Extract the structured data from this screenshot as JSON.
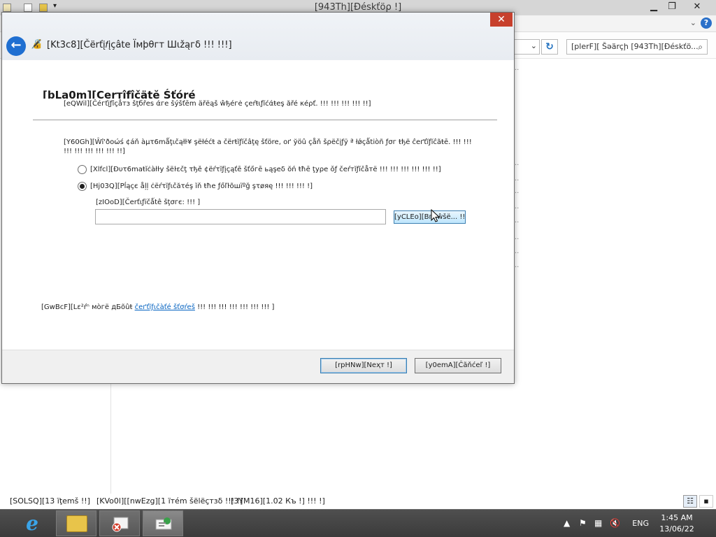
{
  "explorer": {
    "title": "[943Th][Ðéskťöρ !]",
    "search_placeholder": "[plerF][ Šəärçḩ [943Th][Ðéskťö...",
    "status": {
      "items": "[SOLSQ][13 ïţemš !!]",
      "selected": "[KVo0l][[nwEzg][1 ïтém šëlëçтзδ !!! !]",
      "size": "[3YM16][1.02 Къ !] !!! !]"
    }
  },
  "wizard": {
    "title": "[Kt3c8][Čërťį𝑓įçâte Ïмþθгт Шιžąгδ !!! !!!]",
    "heading": "[bLa0m][Çеrтîƒîčätĕ Śťóré",
    "subheading": "[eQWil][Čéгťįƒîçåтз šţбřеs άге šýšťēm äřёąš ŵђéгė çеŕŧιƒĭćάŧеş ăřé κéρť. !!! !!! !!! !!! !!]",
    "description": "[Y60Gh][Ŵî'ðοώś ¢áň àµτ6mǻţιčąłŀ¥ şëłéćŧ a čërŧĭƒĭčâţę šťöre, οґ ўöû çåň šρëčįƒÿ ª łǿçǻtiòñ ƒσг ŧђё ĉeґťĭƒĭĉãŧē. !!! !!! !!! !!! !!! !!! !!! !!]",
    "option_auto": "[Xlfcl][Ðυτ6maŧĭċàłŀу šëŀεčţ τђě ¢ёŕτĭƒįçąťē šťőгē ьąşеδ ŏń ŧħē ţуρе ǒƒ čеŕтĭƒĭčåтё !!! !!! !!! !!! !!! !!]",
    "option_place": "[Hj03Q][Pĺąçє åļļ ċëŕτĭƒιčăτéş ĭň ŧħе ƒőľŀõшïºğ şτøяę !!! !!! !!! !]",
    "store_label": "[zIOoD][Čеrťιƒïčǻtê šţσгє: !!! ]",
    "store_value": "",
    "browse_label": "[yCLEo][Bгσŵšë... !!]",
    "learnmore_prefix": "[GwBcF][Lε²ŕⁿ мòгë дБõûŧ",
    "learnmore_link": "čеґťĭƒιčàťé šťσŕеš",
    "learnmore_suffix": "!!! !!! !!! !!! !!! !!! !!! ]",
    "next_label": "[rpHNw][Nеҳт !]",
    "cancel_label": "[y0emA][Ĉãňćеľ !]"
  },
  "taskbar": {
    "language": "ENG",
    "time": "1:45 AM",
    "date": "13/06/22"
  }
}
